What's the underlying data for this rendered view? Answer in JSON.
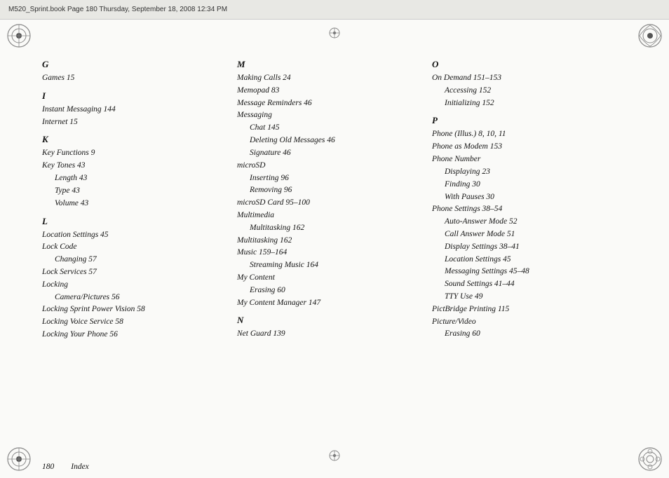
{
  "header": {
    "text": "M520_Sprint.book  Page 180  Thursday, September 18, 2008  12:34 PM"
  },
  "footer": {
    "page_number": "180",
    "label": "Index"
  },
  "columns": [
    {
      "id": "col1",
      "sections": [
        {
          "letter": "G",
          "entries": [
            {
              "level": 1,
              "text": "Games 15"
            }
          ]
        },
        {
          "letter": "I",
          "entries": [
            {
              "level": 1,
              "text": "Instant Messaging 144"
            },
            {
              "level": 1,
              "text": "Internet 15"
            }
          ]
        },
        {
          "letter": "K",
          "entries": [
            {
              "level": 1,
              "text": "Key Functions 9"
            },
            {
              "level": 1,
              "text": "Key Tones 43"
            },
            {
              "level": 2,
              "text": "Length 43"
            },
            {
              "level": 2,
              "text": "Type 43"
            },
            {
              "level": 2,
              "text": "Volume 43"
            }
          ]
        },
        {
          "letter": "L",
          "entries": [
            {
              "level": 1,
              "text": "Location Settings 45"
            },
            {
              "level": 1,
              "text": "Lock Code"
            },
            {
              "level": 2,
              "text": "Changing 57"
            },
            {
              "level": 1,
              "text": "Lock Services 57"
            },
            {
              "level": 1,
              "text": "Locking"
            },
            {
              "level": 2,
              "text": "Camera/Pictures 56"
            },
            {
              "level": 1,
              "text": "Locking Sprint Power Vision 58"
            },
            {
              "level": 1,
              "text": "Locking Voice Service 58"
            },
            {
              "level": 1,
              "text": "Locking Your Phone 56"
            }
          ]
        }
      ]
    },
    {
      "id": "col2",
      "sections": [
        {
          "letter": "M",
          "entries": [
            {
              "level": 1,
              "text": "Making Calls 24"
            },
            {
              "level": 1,
              "text": "Memopad 83"
            },
            {
              "level": 1,
              "text": "Message Reminders 46"
            },
            {
              "level": 1,
              "text": "Messaging"
            },
            {
              "level": 2,
              "text": "Chat 145"
            },
            {
              "level": 2,
              "text": "Deleting Old Messages 46"
            },
            {
              "level": 2,
              "text": "Signature 46"
            },
            {
              "level": 1,
              "text": "microSD"
            },
            {
              "level": 2,
              "text": "Inserting 96"
            },
            {
              "level": 2,
              "text": "Removing 96"
            },
            {
              "level": 1,
              "text": "microSD Card 95–100"
            },
            {
              "level": 1,
              "text": "Multimedia"
            },
            {
              "level": 2,
              "text": "Multitasking 162"
            },
            {
              "level": 1,
              "text": "Multitasking 162"
            },
            {
              "level": 1,
              "text": "Music 159–164"
            },
            {
              "level": 2,
              "text": "Streaming Music 164"
            },
            {
              "level": 1,
              "text": "My Content"
            },
            {
              "level": 2,
              "text": "Erasing 60"
            },
            {
              "level": 1,
              "text": "My Content Manager 147"
            }
          ]
        },
        {
          "letter": "N",
          "entries": [
            {
              "level": 1,
              "text": "Net Guard 139"
            }
          ]
        }
      ]
    },
    {
      "id": "col3",
      "sections": [
        {
          "letter": "O",
          "entries": [
            {
              "level": 1,
              "text": "On Demand 151–153"
            },
            {
              "level": 2,
              "text": "Accessing 152"
            },
            {
              "level": 2,
              "text": "Initializing 152"
            }
          ]
        },
        {
          "letter": "P",
          "entries": [
            {
              "level": 1,
              "text": "Phone (Illus.) 8, 10, 11"
            },
            {
              "level": 1,
              "text": "Phone as Modem 153"
            },
            {
              "level": 1,
              "text": "Phone Number"
            },
            {
              "level": 2,
              "text": "Displaying 23"
            },
            {
              "level": 2,
              "text": "Finding 30"
            },
            {
              "level": 2,
              "text": "With Pauses 30"
            },
            {
              "level": 1,
              "text": "Phone Settings 38–54"
            },
            {
              "level": 2,
              "text": "Auto-Answer Mode 52"
            },
            {
              "level": 2,
              "text": "Call Answer Mode 51"
            },
            {
              "level": 2,
              "text": "Display Settings 38–41"
            },
            {
              "level": 2,
              "text": "Location Settings 45"
            },
            {
              "level": 2,
              "text": "Messaging Settings 45–48"
            },
            {
              "level": 2,
              "text": "Sound Settings 41–44"
            },
            {
              "level": 2,
              "text": "TTY Use 49"
            },
            {
              "level": 1,
              "text": "PictBridge Printing 115"
            },
            {
              "level": 1,
              "text": "Picture/Video"
            },
            {
              "level": 2,
              "text": "Erasing 60"
            }
          ]
        }
      ]
    }
  ]
}
